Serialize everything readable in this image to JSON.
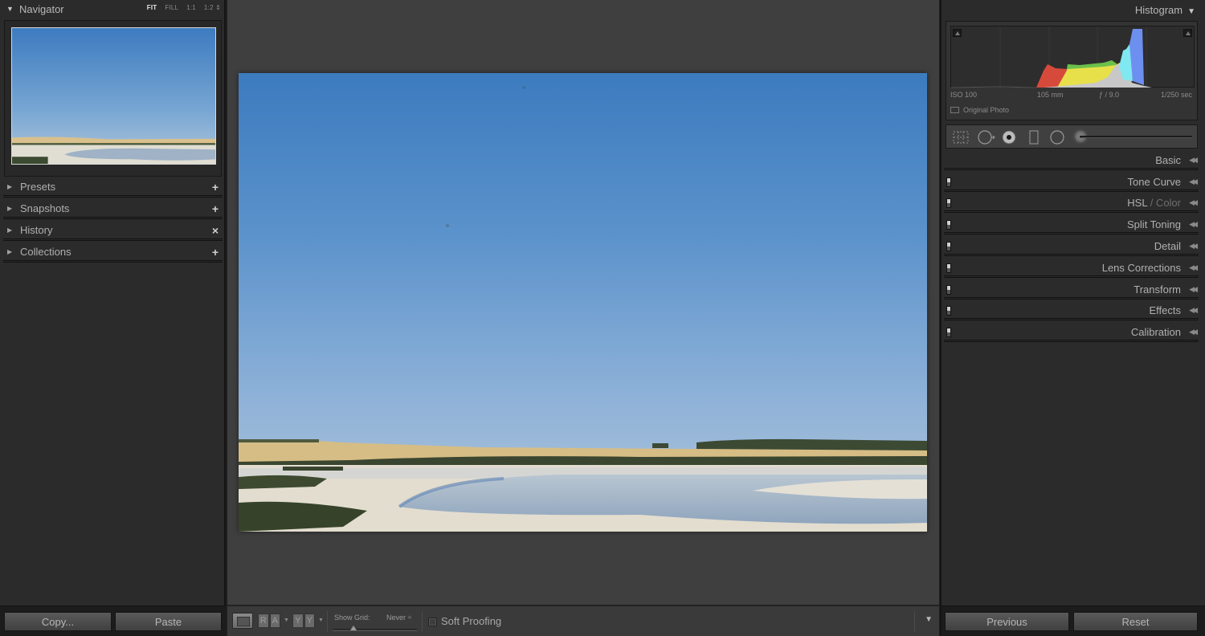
{
  "left_panel": {
    "navigator": {
      "title": "Navigator",
      "zoom_options": [
        "FIT",
        "FILL",
        "1:1",
        "1:2"
      ],
      "active_zoom": "FIT"
    },
    "sections": [
      {
        "label": "Presets",
        "action": "+",
        "action_icon": "plus-dropdown-icon"
      },
      {
        "label": "Snapshots",
        "action": "+",
        "action_icon": "plus-icon"
      },
      {
        "label": "History",
        "action": "×",
        "action_icon": "close-icon"
      },
      {
        "label": "Collections",
        "action": "+",
        "action_icon": "plus-dropdown-icon"
      }
    ],
    "footer": {
      "copy_label": "Copy...",
      "paste_label": "Paste"
    }
  },
  "toolbar": {
    "ra_labels": [
      "R",
      "A"
    ],
    "yy_labels": [
      "Y",
      "Y"
    ],
    "show_grid_label": "Show Grid:",
    "show_grid_value": "Never ÷",
    "soft_proofing_label": "Soft Proofing",
    "soft_proofing_checked": false
  },
  "right_panel": {
    "histogram": {
      "title": "Histogram",
      "iso": "ISO 100",
      "focal_length": "105 mm",
      "aperture": "ƒ / 9.0",
      "shutter": "1/250 sec",
      "original_photo_label": "Original Photo",
      "colors": {
        "red": "#d64a3c",
        "yellow": "#e8e04a",
        "green": "#6bc04a",
        "cyan": "#7fe8f0",
        "blue": "#6d8ff0",
        "gray": "#c8c8c8"
      }
    },
    "tool_strip": {
      "tools": [
        "crop-overlay-icon",
        "spot-removal-icon",
        "red-eye-icon",
        "graduated-filter-icon",
        "radial-filter-icon",
        "adjustment-brush-icon"
      ]
    },
    "sections": [
      {
        "label": "Basic",
        "has_switch": false
      },
      {
        "label": "Tone Curve",
        "has_switch": true
      },
      {
        "label": "HSL",
        "label_dim": " / Color",
        "has_switch": true
      },
      {
        "label": "Split Toning",
        "has_switch": true
      },
      {
        "label": "Detail",
        "has_switch": true
      },
      {
        "label": "Lens Corrections",
        "has_switch": true
      },
      {
        "label": "Transform",
        "has_switch": true
      },
      {
        "label": "Effects",
        "has_switch": true
      },
      {
        "label": "Calibration",
        "has_switch": true
      }
    ],
    "footer": {
      "previous_label": "Previous",
      "reset_label": "Reset"
    }
  },
  "photo": {
    "description": "Salt lake landscape with blue sky, sandy shoreline and shrubs",
    "sky_top": "#3f7dbf",
    "sky_bottom": "#aac3da"
  }
}
